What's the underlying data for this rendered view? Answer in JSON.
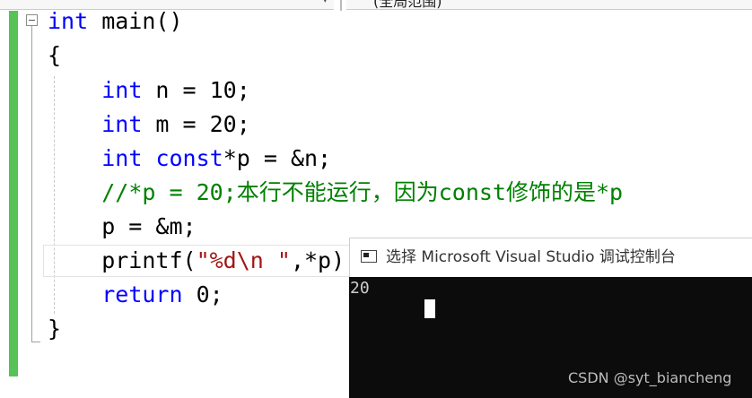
{
  "toolbar": {
    "scope_dropdown_label": "(全局范围)"
  },
  "editor": {
    "lines": [
      {
        "segments": [
          {
            "text": "int",
            "kind": "kw"
          },
          {
            "text": " main()",
            "kind": "plain"
          }
        ]
      },
      {
        "segments": [
          {
            "text": "{",
            "kind": "plain"
          }
        ]
      },
      {
        "segments": [
          {
            "text": "    ",
            "kind": "plain"
          },
          {
            "text": "int",
            "kind": "kw"
          },
          {
            "text": " n = 10;",
            "kind": "plain"
          }
        ]
      },
      {
        "segments": [
          {
            "text": "    ",
            "kind": "plain"
          },
          {
            "text": "int",
            "kind": "kw"
          },
          {
            "text": " m = 20;",
            "kind": "plain"
          }
        ]
      },
      {
        "segments": [
          {
            "text": "    ",
            "kind": "plain"
          },
          {
            "text": "int",
            "kind": "kw"
          },
          {
            "text": " ",
            "kind": "plain"
          },
          {
            "text": "const",
            "kind": "kw"
          },
          {
            "text": "*p = &n;",
            "kind": "plain"
          }
        ]
      },
      {
        "segments": [
          {
            "text": "    ",
            "kind": "plain"
          },
          {
            "text": "//*p = 20;本行不能运行，因为const修饰的是*p",
            "kind": "cm"
          }
        ]
      },
      {
        "segments": [
          {
            "text": "    p = &m;",
            "kind": "plain"
          }
        ]
      },
      {
        "segments": [
          {
            "text": "    printf(",
            "kind": "plain"
          },
          {
            "text": "\"%d\\n \"",
            "kind": "st"
          },
          {
            "text": ",*p);",
            "kind": "plain"
          }
        ]
      },
      {
        "segments": [
          {
            "text": "    ",
            "kind": "plain"
          },
          {
            "text": "return",
            "kind": "kw"
          },
          {
            "text": " 0;",
            "kind": "plain"
          }
        ]
      },
      {
        "segments": [
          {
            "text": "}",
            "kind": "plain"
          }
        ]
      }
    ]
  },
  "console": {
    "title": "选择 Microsoft Visual Studio 调试控制台",
    "output": "20",
    "watermark": "CSDN @syt_biancheng"
  },
  "colors": {
    "keyword": "#0000ff",
    "comment": "#008000",
    "string": "#a31515",
    "change_bar": "#57c257",
    "console_bg": "#0c0c0c"
  }
}
